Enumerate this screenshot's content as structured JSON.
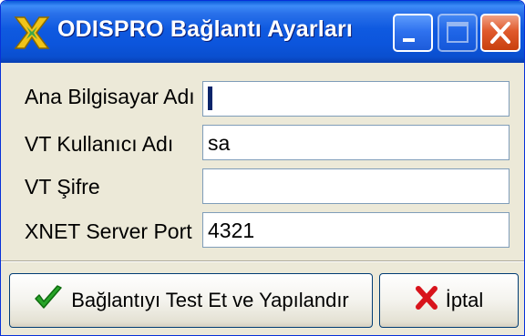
{
  "window": {
    "title": "ODISPRO Bağlantı Ayarları",
    "title_bar_color": "#0a55dc"
  },
  "title_buttons": {
    "minimize_icon": "minimize-icon",
    "maximize_icon": "maximize-icon",
    "close_icon": "close-icon"
  },
  "form": {
    "host": {
      "label": "Ana Bilgisayar Adı",
      "value": ""
    },
    "db_user": {
      "label": "VT Kullanıcı Adı",
      "value": "sa"
    },
    "db_password": {
      "label": "VT Şifre",
      "value": ""
    },
    "xnet_port": {
      "label": "XNET Server Port",
      "value": "4321"
    }
  },
  "buttons": {
    "test_label": "Bağlantıyı Test Et ve Yapılandır",
    "test_icon": "checkmark-icon",
    "cancel_label": "İptal",
    "cancel_icon": "red-x-icon"
  }
}
